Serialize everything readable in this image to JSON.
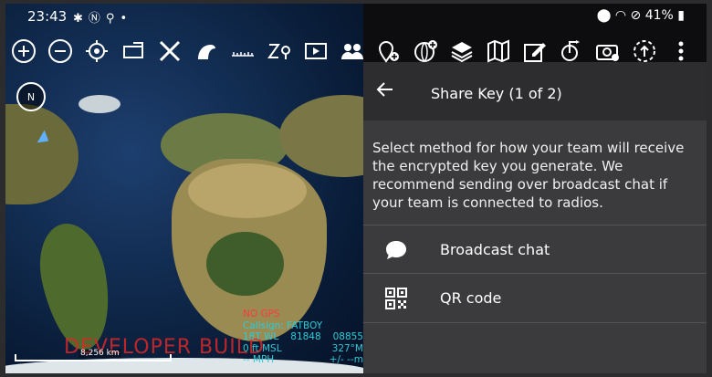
{
  "status_bar": {
    "time": "23:43",
    "notification_icons": [
      "gear-icon",
      "n-badge-icon",
      "location-pin-icon",
      "dot-icon"
    ],
    "battery_text": "41%"
  },
  "toolbar": {
    "tools": [
      {
        "name": "zoom-in-icon",
        "glyph": "+"
      },
      {
        "name": "zoom-out-icon",
        "glyph": "−"
      },
      {
        "name": "locate-icon"
      },
      {
        "name": "layout-icon"
      },
      {
        "name": "close-tools-icon"
      },
      {
        "name": "mission-icon"
      },
      {
        "name": "ruler-icon"
      },
      {
        "name": "go-to-icon"
      },
      {
        "name": "video-icon"
      },
      {
        "name": "contacts-icon"
      },
      {
        "name": "add-marker-icon"
      },
      {
        "name": "add-point-icon"
      },
      {
        "name": "layers-icon"
      },
      {
        "name": "map-icon"
      },
      {
        "name": "edit-icon"
      },
      {
        "name": "route-icon"
      },
      {
        "name": "camera-icon"
      },
      {
        "name": "sync-icon"
      },
      {
        "name": "overflow-menu-icon"
      }
    ]
  },
  "map": {
    "compass_label": "N",
    "scale_label": "8,256 km",
    "watermark": "DEVELOPER BUILD",
    "info": {
      "gps_status": "NO GPS",
      "callsign": "Callsign: FATBOY",
      "grid_zone": "18T WL",
      "easting": "81848",
      "northing": "08855",
      "altitude": "0 ft MSL",
      "heading": "327°M",
      "speed": "-- MPH",
      "accuracy": "+/- --m"
    }
  },
  "panel": {
    "title": "Share Key (1 of 2)",
    "description": "Select method for how your team will receive the encrypted key you generate. We recommend sending over broadcast chat if your team is connected to radios.",
    "options": [
      {
        "label": "Broadcast chat",
        "icon": "chat-bubble-icon"
      },
      {
        "label": "QR code",
        "icon": "qr-code-icon"
      }
    ]
  }
}
